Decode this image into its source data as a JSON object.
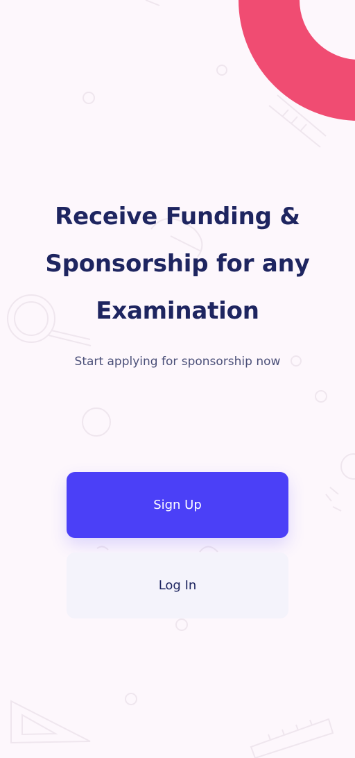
{
  "colors": {
    "background": "#fdf7fc",
    "primary": "#4b40f7",
    "accent": "#f04c72",
    "heading": "#1e2560",
    "subtitle": "#4a4f78",
    "secondary_button_bg": "#f4f3fb"
  },
  "hero": {
    "title_line1": "Receive Funding &",
    "title_line2": "Sponsorship for any",
    "title_line3": "Examination",
    "subtitle": "Start applying for sponsorship now"
  },
  "actions": {
    "signup_label": "Sign Up",
    "login_label": "Log In"
  },
  "decorations": {
    "ring_icon": "ring-shape",
    "background_icons": [
      "search-icon",
      "ruler-icon",
      "triangle-ruler-icon",
      "circle-doodle"
    ]
  }
}
